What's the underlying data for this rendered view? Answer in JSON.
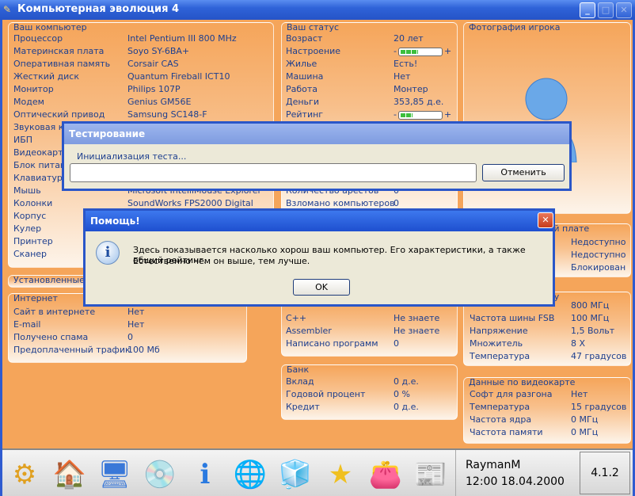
{
  "window": {
    "title": "Компьютерная эволюция 4",
    "min": "_",
    "max": "□",
    "close": "✕"
  },
  "computer": {
    "title": "Ваш компьютер",
    "rows": [
      [
        "Процессор",
        "Intel Pentium III 800 MHz"
      ],
      [
        "Материнская плата",
        "Soyo SY-6BA+"
      ],
      [
        "Оперативная память",
        "Corsair CAS"
      ],
      [
        "Жесткий диск",
        "Quantum Fireball ICT10"
      ],
      [
        "Монитор",
        "Philips 107P"
      ],
      [
        "Модем",
        "Genius GM56E"
      ],
      [
        "Оптический привод",
        "Samsung SC148-F"
      ],
      [
        "Звуковая карта",
        ""
      ],
      [
        "ИБП",
        ""
      ],
      [
        "Видеокарта",
        ""
      ],
      [
        "Блок питания",
        ""
      ],
      [
        "Клавиатура",
        ""
      ],
      [
        "Мышь",
        "Microsoft IntelliMouse Explorer"
      ],
      [
        "Колонки",
        "SoundWorks FPS2000 Digital"
      ],
      [
        "Корпус",
        ""
      ],
      [
        "Кулер",
        ""
      ],
      [
        "Принтер",
        ""
      ],
      [
        "Сканер",
        ""
      ]
    ]
  },
  "installed": {
    "title": "Установленные"
  },
  "internet": {
    "title": "Интернет",
    "rows": [
      [
        "Сайт в интернете",
        "Нет"
      ],
      [
        "E-mail",
        "Нет"
      ],
      [
        "Получено спама",
        "0"
      ],
      [
        "Предоплаченный трафик",
        "100 Мб"
      ]
    ]
  },
  "status": {
    "title": "Ваш статус",
    "rows": [
      [
        "Возраст",
        "20 лет"
      ],
      [
        "Настроение",
        ""
      ],
      [
        "Жилье",
        "Есть!"
      ],
      [
        "Машина",
        "Нет"
      ],
      [
        "Работа",
        "Монтер"
      ],
      [
        "Деньги",
        "353,85 д.е."
      ],
      [
        "Рейтинг",
        ""
      ]
    ],
    "mood_level": 0.4,
    "rating_level": 0.27,
    "minus": "-",
    "plus": "+",
    "rows2": [
      [
        "Количество арестов",
        "0"
      ],
      [
        "Взломано компьютеров",
        "0"
      ]
    ]
  },
  "programming": {
    "rows": [
      [
        "C++",
        "Не знаете"
      ],
      [
        "Assembler",
        "Не знаете"
      ],
      [
        "Написано программ",
        "0"
      ]
    ]
  },
  "bank": {
    "title": "Банк",
    "rows": [
      [
        "Вклад",
        "0 д.е."
      ],
      [
        "Годовой процент",
        "0 %"
      ],
      [
        "Кредит",
        "0 д.е."
      ]
    ]
  },
  "photo": {
    "title": "Фотография игрока"
  },
  "motherboard": {
    "title": "кой плате",
    "rows": [
      [
        "",
        "Недоступно"
      ],
      [
        "",
        "Недоступно"
      ],
      [
        "",
        "Блокирован"
      ]
    ]
  },
  "cpu": {
    "title": "ору",
    "rows": [
      [
        "",
        "800 МГц"
      ],
      [
        "Частота шины FSB",
        "100 МГц"
      ],
      [
        "Напряжение",
        "1,5 Вольт"
      ],
      [
        "Множитель",
        "8 X"
      ],
      [
        "Температура",
        "47 градусов"
      ]
    ]
  },
  "video": {
    "title": "Данные по видеокарте",
    "rows": [
      [
        "Софт для разгона",
        "Нет"
      ],
      [
        "Температура",
        "15 градусов"
      ],
      [
        "Частота ядра",
        "0 МГц"
      ],
      [
        "Частота памяти",
        "0 МГц"
      ]
    ]
  },
  "test_dialog": {
    "title": "Тестирование",
    "label": "Инициализация теста...",
    "progress": 0,
    "cancel": "Отменить"
  },
  "help_dialog": {
    "title": "Помощь!",
    "line1": "Здесь показывается насколько хорош ваш компьютер. Его характеристики, а также общий рейтинг.",
    "line2": "Естественно чем он выше, тем лучше.",
    "ok": "OK",
    "close": "✕"
  },
  "taskbar": {
    "user": "RaymanM",
    "datetime": "12:00 18.04.2000",
    "version": "4.1.2",
    "icons": [
      [
        "kde-start-icon",
        "⚙"
      ],
      [
        "home-icon",
        "🏠"
      ],
      [
        "computer-icon",
        "🖥"
      ],
      [
        "install-icon",
        "💿"
      ],
      [
        "info-icon",
        "ℹ"
      ],
      [
        "internet-icon",
        "🌐"
      ],
      [
        "programs-icon",
        "🧊"
      ],
      [
        "star-icon",
        "★"
      ],
      [
        "wallet-icon",
        "👛"
      ],
      [
        "newspaper-icon",
        "📰"
      ]
    ]
  }
}
